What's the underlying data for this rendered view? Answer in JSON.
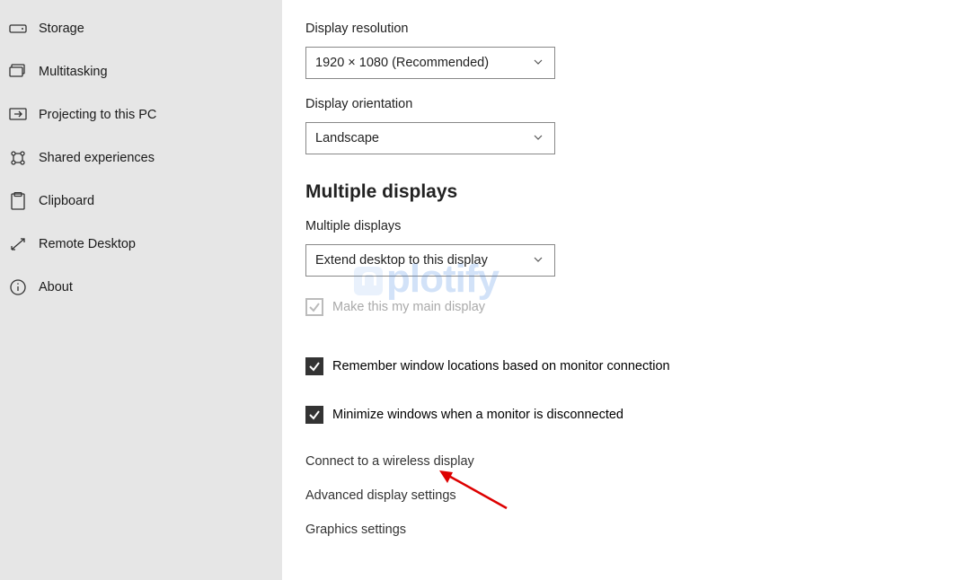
{
  "sidebar": {
    "items": [
      {
        "label": "Storage",
        "icon": "storage-icon"
      },
      {
        "label": "Multitasking",
        "icon": "multitasking-icon"
      },
      {
        "label": "Projecting to this PC",
        "icon": "projecting-icon"
      },
      {
        "label": "Shared experiences",
        "icon": "shared-icon"
      },
      {
        "label": "Clipboard",
        "icon": "clipboard-icon"
      },
      {
        "label": "Remote Desktop",
        "icon": "remote-desktop-icon"
      },
      {
        "label": "About",
        "icon": "about-icon"
      }
    ]
  },
  "main": {
    "resolution_label": "Display resolution",
    "resolution_value": "1920 × 1080 (Recommended)",
    "orientation_label": "Display orientation",
    "orientation_value": "Landscape",
    "section_multi": "Multiple displays",
    "multi_label": "Multiple displays",
    "multi_value": "Extend desktop to this display",
    "cb_main": "Make this my main display",
    "cb_remember": "Remember window locations based on monitor connection",
    "cb_minimize": "Minimize windows when a monitor is disconnected",
    "link_wireless": "Connect to a wireless display",
    "link_advanced": "Advanced display settings",
    "link_graphics": "Graphics settings"
  },
  "watermark": "plotify"
}
